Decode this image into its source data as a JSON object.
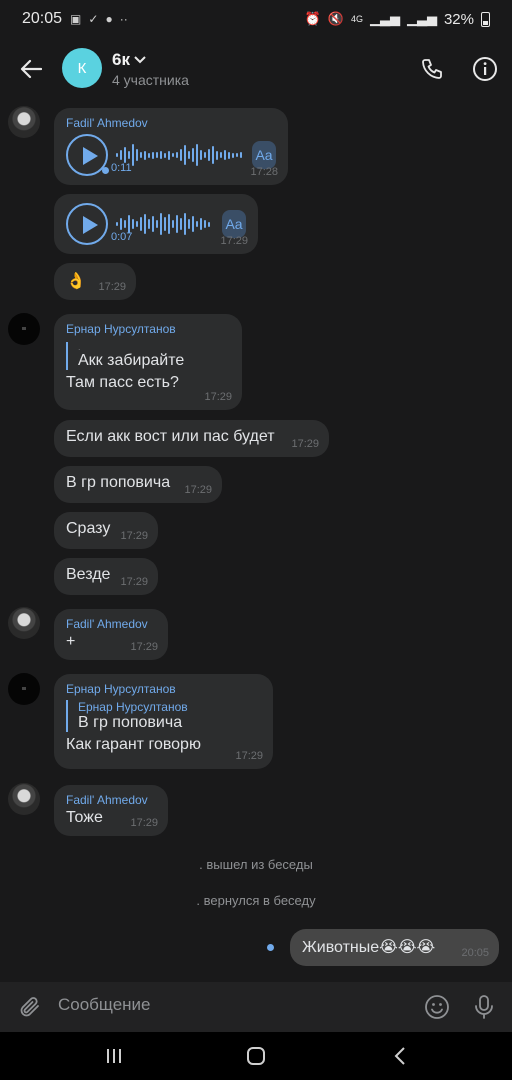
{
  "status_bar": {
    "time": "20:05",
    "battery": "32%",
    "network": "4G"
  },
  "header": {
    "avatar_letter": "К",
    "title": "6к",
    "subtitle": "4 участника"
  },
  "messages": [
    {
      "id": "m1",
      "sender": "Fadil' Ahmedov",
      "type": "voice",
      "duration": "0:11",
      "time": "17:28",
      "transcribe_label": "Aa",
      "unread": true
    },
    {
      "id": "m2",
      "type": "voice",
      "duration": "0:07",
      "time": "17:29",
      "transcribe_label": "Aa"
    },
    {
      "id": "m3",
      "type": "text",
      "text": "👌",
      "time": "17:29"
    },
    {
      "id": "m4",
      "sender": "Ернар Нурсултанов",
      "type": "text",
      "quote_text": "Акк забирайте",
      "quote_sender": ".",
      "text": "Там пасс есть?",
      "time": "17:29"
    },
    {
      "id": "m5",
      "type": "text",
      "text": "Если акк вост или пас будет",
      "time": "17:29"
    },
    {
      "id": "m6",
      "type": "text",
      "text": "В гр поповича",
      "time": "17:29"
    },
    {
      "id": "m7",
      "type": "text",
      "text": "Сразу",
      "time": "17:29"
    },
    {
      "id": "m8",
      "type": "text",
      "text": "Везде",
      "time": "17:29"
    },
    {
      "id": "m9",
      "sender": "Fadil' Ahmedov",
      "type": "text",
      "text": "+",
      "time": "17:29"
    },
    {
      "id": "m10",
      "sender": "Ернар Нурсултанов",
      "type": "text",
      "quote_sender": "Ернар Нурсултанов",
      "quote_text": "В гр поповича",
      "text": "Как гарант говорю",
      "time": "17:29"
    },
    {
      "id": "m11",
      "sender": "Fadil' Ahmedov",
      "type": "text",
      "text": "Тоже",
      "time": "17:29"
    }
  ],
  "service_messages": [
    ". вышел из беседы",
    ". вернулся в беседу"
  ],
  "outgoing": {
    "text": "Животные😭😭😭",
    "time": "20:05",
    "status": "sending"
  },
  "composer": {
    "placeholder": "Сообщение"
  },
  "icons": {
    "back": "arrow-left-icon",
    "call": "phone-icon",
    "info": "info-icon",
    "attach": "paperclip-icon",
    "emoji": "smiley-icon",
    "mic": "microphone-icon"
  }
}
